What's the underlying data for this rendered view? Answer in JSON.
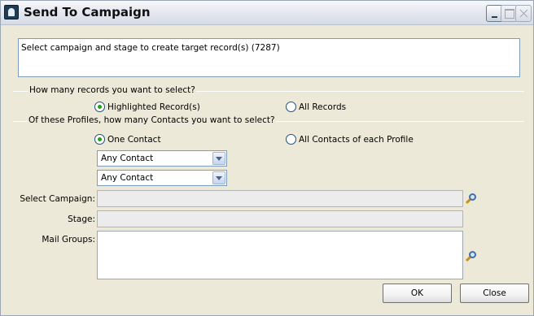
{
  "window": {
    "title": "Send To Campaign"
  },
  "icons": {
    "app": "campaign-app-icon",
    "minimize": "minimize-icon",
    "maximize": "maximize-icon",
    "close": "close-icon",
    "lookup": "magnifier-icon",
    "dropdown": "chevron-down-icon"
  },
  "message": "Select campaign and stage to create target record(s) (7287)",
  "records_group": {
    "label": "How many records you want to select?",
    "options": [
      "Highlighted Record(s)",
      "All Records"
    ],
    "selected": "Highlighted Record(s)"
  },
  "contacts_group": {
    "label": "Of these Profiles, how many Contacts you want to select?",
    "options": [
      "One Contact",
      "All Contacts of each Profile"
    ],
    "selected": "One Contact"
  },
  "contact_selects": [
    "Any Contact",
    "Any Contact"
  ],
  "fields": {
    "campaign_label": "Select Campaign:",
    "campaign_value": "",
    "stage_label": "Stage:",
    "stage_value": "",
    "mail_groups_label": "Mail Groups:",
    "mail_groups_value": ""
  },
  "buttons": {
    "ok": "OK",
    "close": "Close"
  },
  "colors": {
    "dialog_background": "#ece9d8",
    "input_border": "#7f9db9",
    "radio_dot": "#21a121"
  }
}
